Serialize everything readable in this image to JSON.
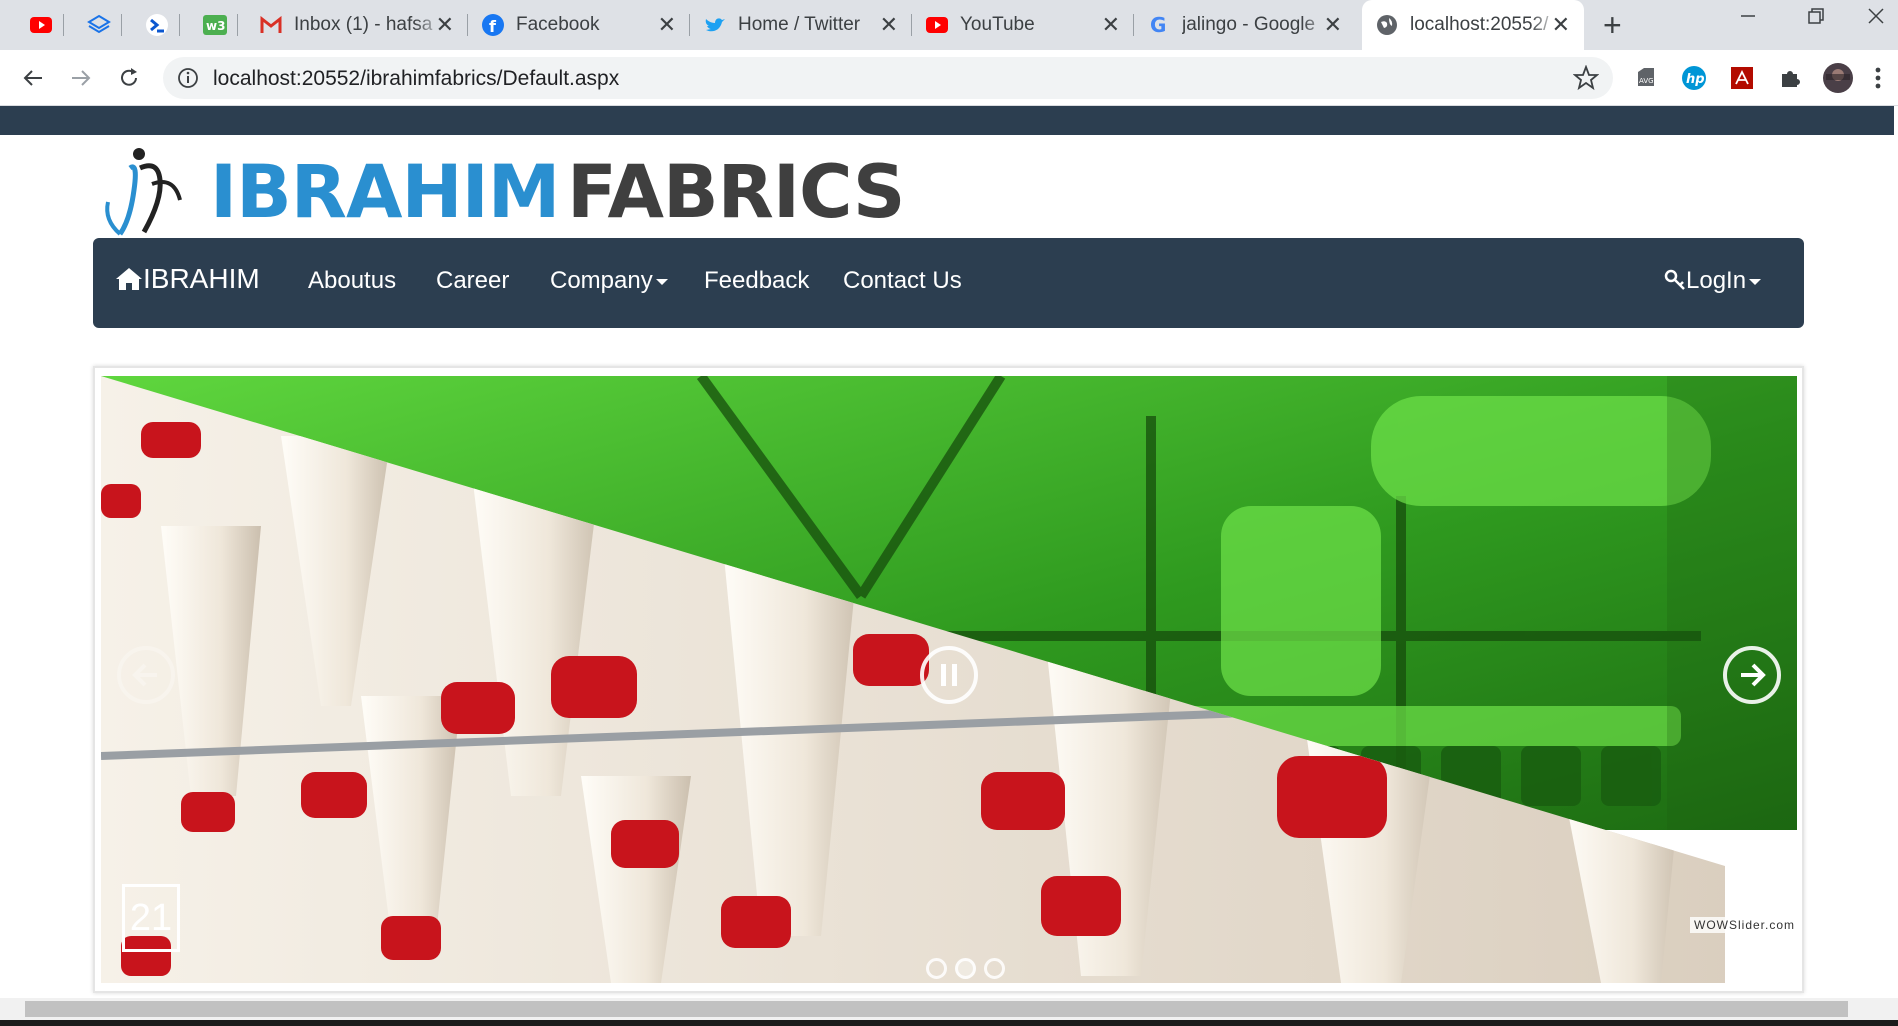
{
  "browser": {
    "pinned_tabs": [
      "youtube-icon",
      "stack-icon",
      "terminal-icon",
      "w3-icon"
    ],
    "tabs": [
      {
        "title": "Inbox (1) - hafsa",
        "icon": "gmail-icon",
        "color": "#d93025"
      },
      {
        "title": "Facebook",
        "icon": "facebook-icon",
        "color": "#1877f2"
      },
      {
        "title": "Home / Twitter",
        "icon": "twitter-icon",
        "color": "#1da1f2"
      },
      {
        "title": "YouTube",
        "icon": "youtube-icon",
        "color": "#ff0000"
      },
      {
        "title": "jalingo - Google",
        "icon": "google-icon",
        "color": "#4285f4"
      },
      {
        "title": "localhost:20552/",
        "icon": "globe-icon",
        "color": "#5f6368",
        "active": true
      }
    ],
    "close_glyph": "✕",
    "new_tab_glyph": "+",
    "address": "localhost:20552/ibrahimfabrics/Default.aspx",
    "extensions": [
      "avg-icon",
      "hp-icon",
      "acrobat-icon",
      "puzzle-icon",
      "profile-avatar"
    ]
  },
  "site": {
    "logo_part1": "IBRAHIM",
    "logo_part2": "FABRICS",
    "nav": {
      "brand": "IBRAHIM",
      "items": [
        "Aboutus",
        "Career",
        "Company",
        "Feedback",
        "Contact Us"
      ],
      "login": "LogIn"
    },
    "slider": {
      "counter": "21",
      "slide_count": 3,
      "active_slide": 2,
      "credit": "WOWSlider.com",
      "colors": {
        "upper": "#38b02a",
        "lower": "#e8ddd0",
        "spool": "#c8141c"
      }
    }
  }
}
